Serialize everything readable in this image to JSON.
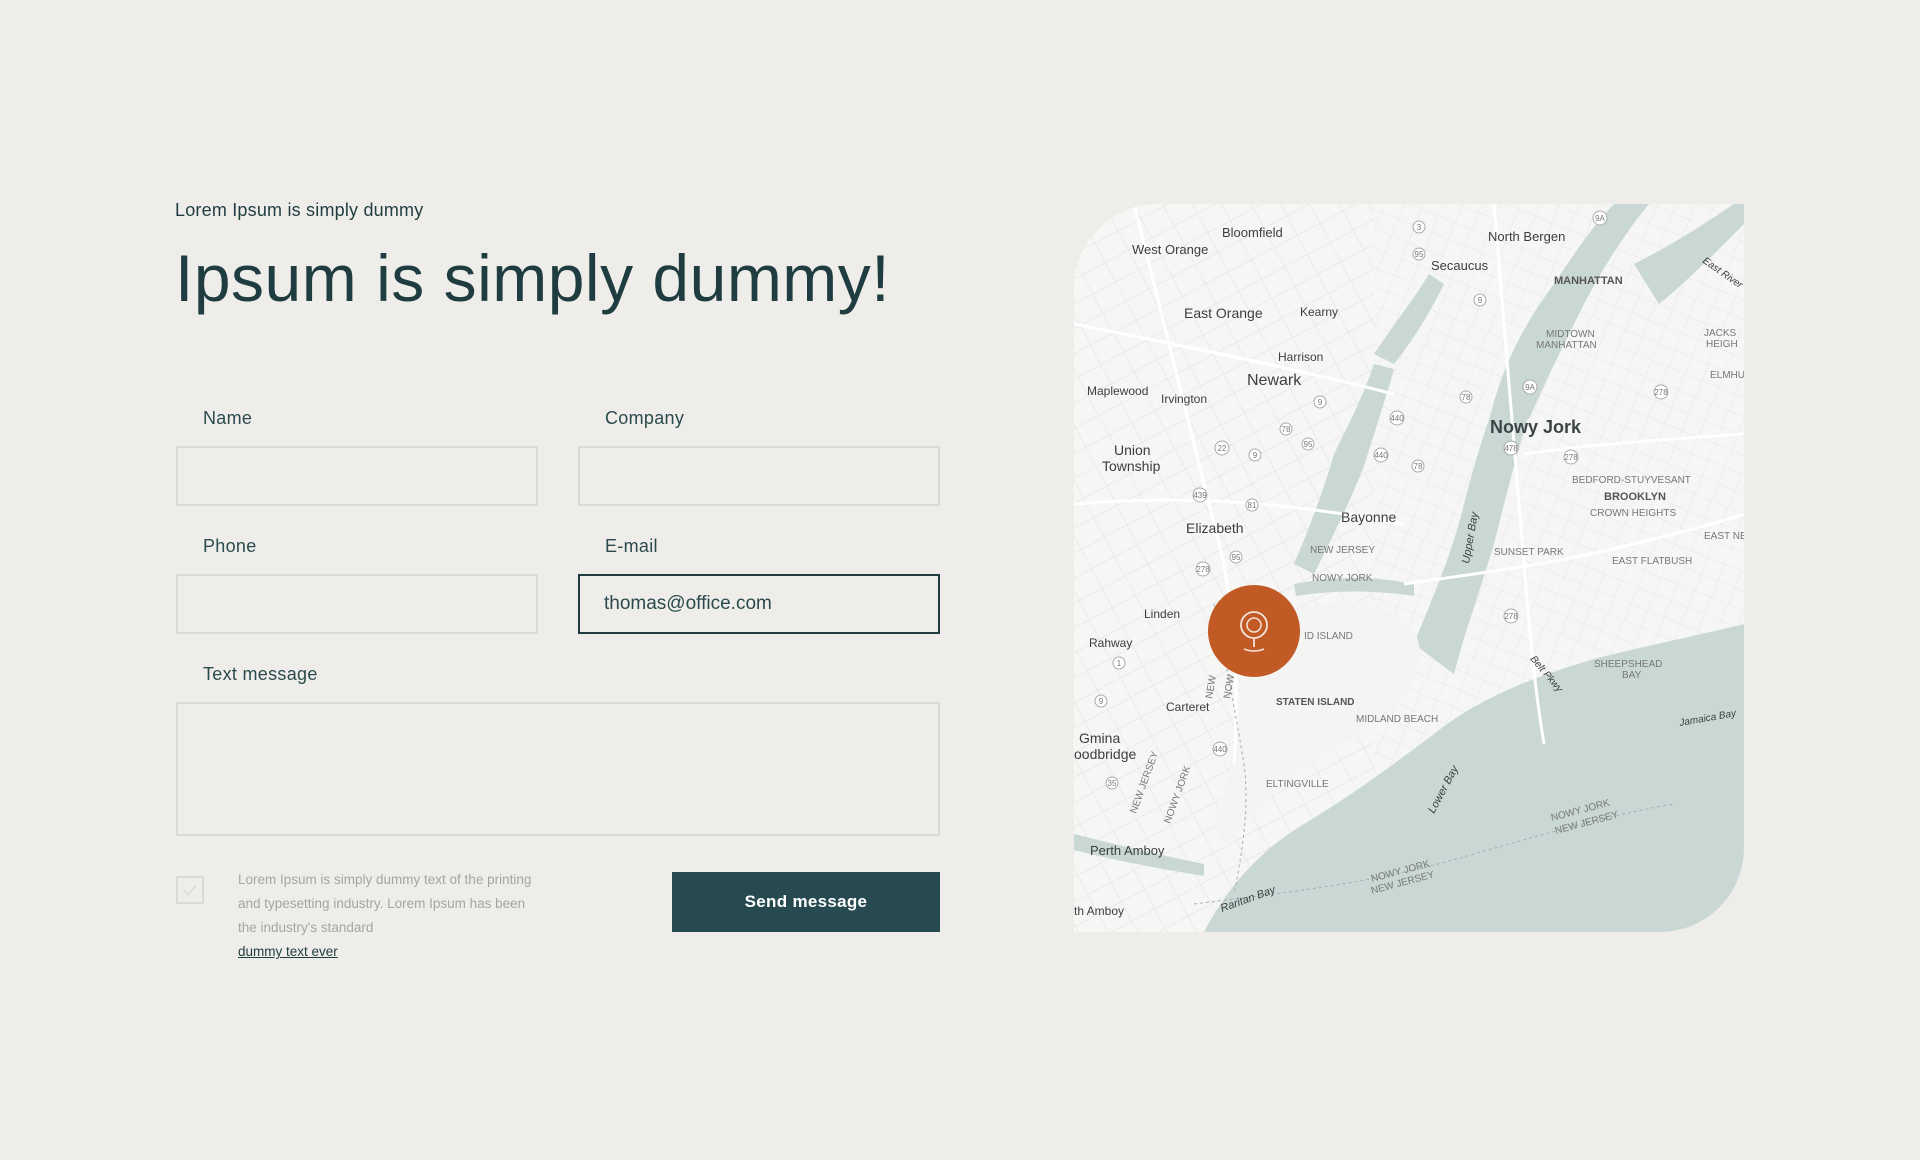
{
  "header": {
    "eyebrow": "Lorem Ipsum is simply dummy",
    "title": "Ipsum is simply dummy!"
  },
  "form": {
    "name": {
      "label": "Name",
      "value": "",
      "placeholder": ""
    },
    "company": {
      "label": "Company",
      "value": "",
      "placeholder": ""
    },
    "phone": {
      "label": "Phone",
      "value": "",
      "placeholder": ""
    },
    "email": {
      "label": "E-mail",
      "value": "thomas@office.com",
      "placeholder": ""
    },
    "message": {
      "label": "Text message",
      "value": "",
      "placeholder": ""
    },
    "consent": {
      "checked": false,
      "text": "Lorem Ipsum is simply dummy text of the printing and typesetting industry. Lorem Ipsum has been the industry's standard",
      "link": "dummy text ever"
    },
    "submit_label": "Send message"
  },
  "map": {
    "labels": {
      "bloomfield": "Bloomfield",
      "north_bergen": "North Bergen",
      "west_orange": "West Orange",
      "secaucus": "Secaucus",
      "manhattan": "MANHATTAN",
      "east_river": "East River",
      "east_orange": "East Orange",
      "kearny": "Kearny",
      "midtown": "MIDTOWN",
      "manhattan2": "MANHATTAN",
      "jackson": "JACKS",
      "heights": "HEIGH",
      "harrison": "Harrison",
      "elmhu": "ELMHU",
      "maplewood": "Maplewood",
      "irvington": "Irvington",
      "newark": "Newark",
      "nowy_jork": "Nowy Jork",
      "union": "Union",
      "township": "Township",
      "bedford": "BEDFORD-STUYVESANT",
      "brooklyn": "BROOKLYN",
      "crown": "CROWN HEIGHTS",
      "bayonne": "Bayonne",
      "elizabeth": "Elizabeth",
      "upper_bay": "Upper Bay",
      "east_ne": "EAST NE",
      "new_jersey": "NEW JERSEY",
      "sunset_park": "SUNSET PARK",
      "east_flatbush": "EAST FLATBUSH",
      "nowy_jork_caps": "NOWY JORK",
      "linden": "Linden",
      "island_frag": "ID ISLAND",
      "rahway": "Rahway",
      "belt_pkwy": "Belt Pkwy",
      "sheepshead": "SHEEPSHEAD",
      "bay": "BAY",
      "carteret": "Carteret",
      "staten_island": "STATEN ISLAND",
      "jamaica_bay": "Jamaica Bay",
      "midland_beach": "MIDLAND BEACH",
      "gmina": "Gmina",
      "woodbridge": "oodbridge",
      "eltingville": "ELTINGVILLE",
      "lower_bay": "Lower Bay",
      "perth_amboy": "Perth Amboy",
      "raritan_bay": "Raritan Bay",
      "south_amboy": "th Amboy",
      "border_ny": "NOWY JORK",
      "border_nj": "NEW JERSEY",
      "border_ny2": "NOWY JORK",
      "border_nj2": "NEW JERSEY",
      "border_nj3": "NEW JERSEY",
      "border_ny3": "NOWY JORK",
      "new_short": "NEW",
      "nowy_short": "NOW"
    },
    "shields": {
      "s3": "3",
      "s95": "95",
      "s9a": "9A",
      "s9": "9",
      "s9b": "9",
      "s440": "440",
      "s78": "78",
      "s22": "22",
      "s9c": "9",
      "s95b": "95",
      "s440b": "440",
      "s439": "439",
      "s81": "81",
      "s278": "278",
      "s95c": "95",
      "s1": "1",
      "s9d": "9",
      "s440c": "440",
      "s35": "35",
      "s278b": "278",
      "s478": "478",
      "s78b": "78",
      "s278c": "278",
      "s9a2": "9A",
      "s78c": "78",
      "s278d": "278"
    },
    "pin_icon": "map-pin-icon"
  },
  "colors": {
    "background": "#efedea",
    "primary": "#264a50",
    "text": "#1f3d40",
    "pin": "#c25a26",
    "water": "#c9d8d5",
    "land": "#f6f6f4"
  }
}
